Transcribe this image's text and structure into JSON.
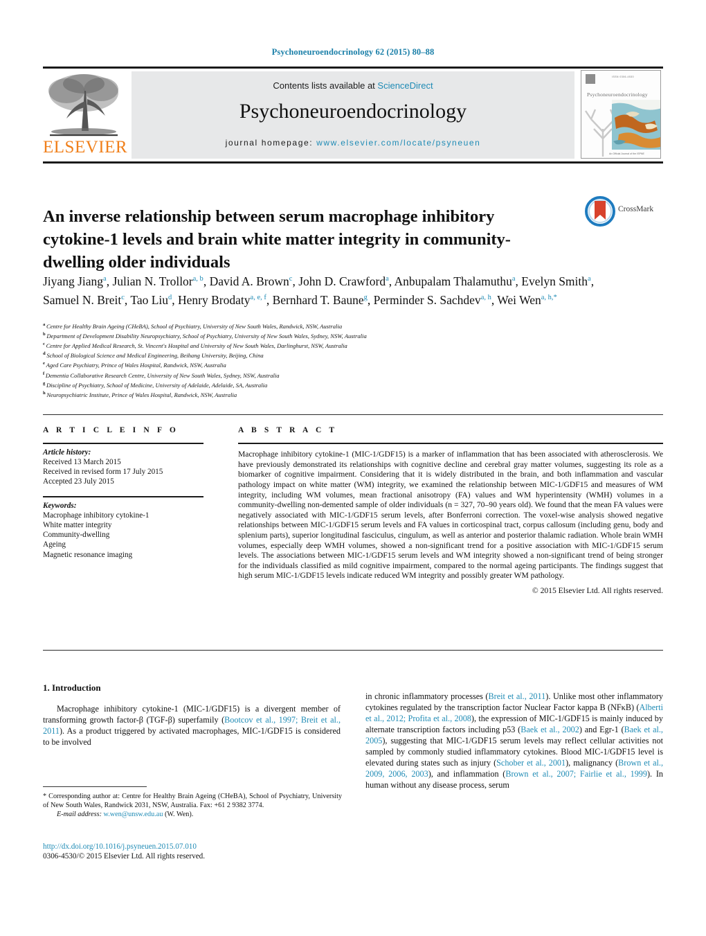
{
  "running_head": "Psychoneuroendocrinology 62 (2015) 80–88",
  "banner": {
    "publisher_logo_text": "ELSEVIER",
    "contents_prefix": "Contents lists available at ",
    "contents_link": "ScienceDirect",
    "journal_name": "Psychoneuroendocrinology",
    "homepage_prefix": "journal homepage: ",
    "homepage_url": "www.elsevier.com/locate/psyneuen",
    "cover": {
      "title": "Psychoneuroendocrinology",
      "issn_text": "ISSN  0306-4530",
      "footer_text": "An Official Journal of the ISPNE"
    }
  },
  "article": {
    "title": "An inverse relationship between serum macrophage inhibitory cytokine-1 levels and brain white matter integrity in community-dwelling older individuals",
    "crossmark_label": "CrossMark",
    "authors": [
      {
        "name": "Jiyang Jiang",
        "sup": "a",
        "sep": ", "
      },
      {
        "name": "Julian N. Trollor",
        "sup": "a, b",
        "sep": ", "
      },
      {
        "name": "David A. Brown",
        "sup": "c",
        "sep": ", "
      },
      {
        "name": "John D. Crawford",
        "sup": "a",
        "sep": ", "
      },
      {
        "name": "Anbupalam Thalamuthu",
        "sup": "a",
        "sep": ", "
      },
      {
        "name": "Evelyn Smith",
        "sup": "a",
        "sep": ", "
      },
      {
        "name": "Samuel N. Breit",
        "sup": "c",
        "sep": ", "
      },
      {
        "name": "Tao Liu",
        "sup": "d",
        "sep": ", "
      },
      {
        "name": "Henry Brodaty",
        "sup": "a, e, f",
        "sep": ", "
      },
      {
        "name": "Bernhard T. Baune",
        "sup": "g",
        "sep": ", "
      },
      {
        "name": "Perminder S. Sachdev",
        "sup": "a, h",
        "sep": ", "
      },
      {
        "name": "Wei Wen",
        "sup": "a, h,",
        "sup_star": "*",
        "sep": ""
      }
    ],
    "affiliations": [
      {
        "label": "a",
        "text": "Centre for Healthy Brain Ageing (CHeBA), School of Psychiatry, University of New South Wales, Randwick, NSW, Australia"
      },
      {
        "label": "b",
        "text": "Department of Development Disability Neuropsychiatry, School of Psychiatry, University of New South Wales, Sydney, NSW, Australia"
      },
      {
        "label": "c",
        "text": "Centre for Applied Medical Research, St. Vincent's Hospital and University of New South Wales, Darlinghurst, NSW, Australia"
      },
      {
        "label": "d",
        "text": "School of Biological Science and Medical Engineering, Beihang University, Beijing, China"
      },
      {
        "label": "e",
        "text": "Aged Care Psychiatry, Prince of Wales Hospital, Randwick, NSW, Australia"
      },
      {
        "label": "f",
        "text": "Dementia Collaborative Research Centre, University of New South Wales, Sydney, NSW, Australia"
      },
      {
        "label": "g",
        "text": "Discipline of Psychiatry, School of Medicine, University of Adelaide, Adelaide, SA, Australia"
      },
      {
        "label": "h",
        "text": "Neuropsychiatric Institute, Prince of Wales Hospital, Randwick, NSW, Australia"
      }
    ]
  },
  "article_info": {
    "heading": "A R T I C L E   I N F O",
    "history_label": "Article history:",
    "history": [
      "Received 13 March 2015",
      "Received in revised form 17 July 2015",
      "Accepted 23 July 2015"
    ],
    "keywords_label": "Keywords:",
    "keywords": [
      "Macrophage inhibitory cytokine-1",
      "White matter integrity",
      "Community-dwelling",
      "Ageing",
      "Magnetic resonance imaging"
    ]
  },
  "abstract": {
    "heading": "A B S T R A C T",
    "text": "Macrophage inhibitory cytokine-1 (MIC-1/GDF15) is a marker of inflammation that has been associated with atherosclerosis. We have previously demonstrated its relationships with cognitive decline and cerebral gray matter volumes, suggesting its role as a biomarker of cognitive impairment. Considering that it is widely distributed in the brain, and both inflammation and vascular pathology impact on white matter (WM) integrity, we examined the relationship between MIC-1/GDF15 and measures of WM integrity, including WM volumes, mean fractional anisotropy (FA) values and WM hyperintensity (WMH) volumes in a community-dwelling non-demented sample of older individuals (n = 327, 70–90 years old). We found that the mean FA values were negatively associated with MIC-1/GDF15 serum levels, after Bonferroni correction. The voxel-wise analysis showed negative relationships between MIC-1/GDF15 serum levels and FA values in corticospinal tract, corpus callosum (including genu, body and splenium parts), superior longitudinal fasciculus, cingulum, as well as anterior and posterior thalamic radiation. Whole brain WMH volumes, especially deep WMH volumes, showed a non-significant trend for a positive association with MIC-1/GDF15 serum levels. The associations between MIC-1/GDF15 serum levels and WM integrity showed a non-significant trend of being stronger for the individuals classified as mild cognitive impairment, compared to the normal ageing participants. The findings suggest that high serum MIC-1/GDF15 levels indicate reduced WM integrity and possibly greater WM pathology.",
    "copyright": "© 2015 Elsevier Ltd. All rights reserved."
  },
  "body": {
    "section_heading": "1. Introduction",
    "left_column_html": "Macrophage inhibitory cytokine-1 (MIC-1/GDF15) is a divergent member of transforming growth factor-β (TGF-β) superfamily (<span class=\"ref\">Bootcov et al., 1997; Breit et al., 2011</span>). As a product triggered by activated macrophages, MIC-1/GDF15 is considered to be involved",
    "right_column_html": "in chronic inflammatory processes (<span class=\"ref\">Breit et al., 2011</span>). Unlike most other inflammatory cytokines regulated by the transcription factor Nuclear Factor kappa B (NFκB) (<span class=\"ref\">Alberti et al., 2012; Profita et al., 2008</span>), the expression of MIC-1/GDF15 is mainly induced by alternate transcription factors including p53 (<span class=\"ref\">Baek et al., 2002</span>) and Egr-1 (<span class=\"ref\">Baek et al., 2005</span>), suggesting that MIC-1/GDF15 serum levels may reflect cellular activities not sampled by commonly studied inflammatory cytokines. Blood MIC-1/GDF15 level is elevated during states such as injury (<span class=\"ref\">Schober et al., 2001</span>), malignancy (<span class=\"ref\">Brown et al., 2009, 2006, 2003</span>), and inflammation (<span class=\"ref\">Brown et al., 2007; Fairlie et al., 1999</span>). In human without any disease process, serum"
  },
  "footnote": {
    "corresponding_html": "* Corresponding author at: Centre for Healthy Brain Ageing (CHeBA), School of Psychiatry, University of New South Wales, Randwick 2031, NSW, Australia. Fax: +61 2 9382 3774.",
    "email_label": "E-mail address:",
    "email": "w.wen@unsw.edu.au",
    "email_suffix": "(W. Wen).",
    "doi": "http://dx.doi.org/10.1016/j.psyneuen.2015.07.010",
    "issn_copyright": "0306-4530/© 2015 Elsevier Ltd. All rights reserved."
  },
  "colors": {
    "link": "#1f8bb5",
    "elsevier_orange": "#f07f1a",
    "banner_gray": "#e7e8e9",
    "crossmark_blue": "#1e7bbf",
    "crossmark_red": "#d8422c"
  }
}
